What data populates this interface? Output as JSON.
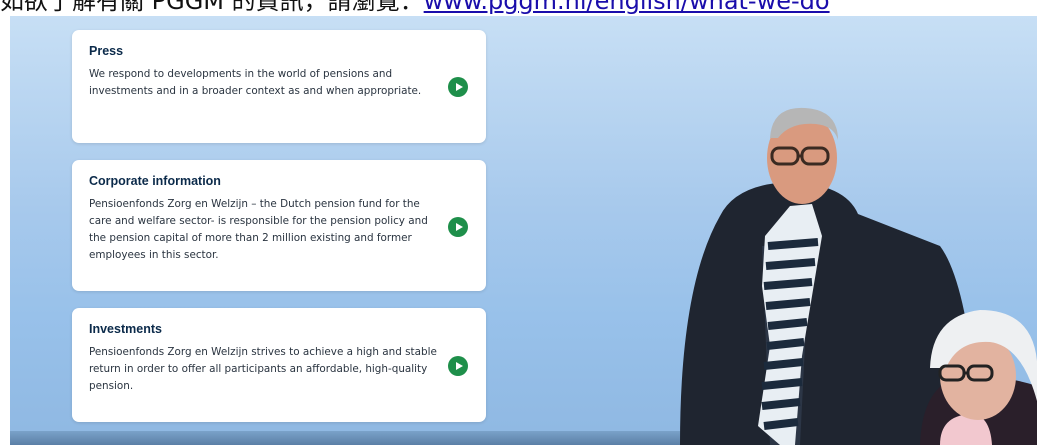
{
  "header": {
    "text": "如欲了解有關 PGGM 的資訊，請瀏覽：",
    "link_text": "www.pggm.nl/english/what-we-do"
  },
  "cards": [
    {
      "title": "Press",
      "body": "We respond to developments in the world of pensions and investments and in a broader context as and when appropriate."
    },
    {
      "title": "Corporate information",
      "body": "Pensioenfonds Zorg en Welzijn – the Dutch pension fund for the care and welfare sector- is responsible for the pension policy and the pension capital of more than 2 million existing and former employees in this sector."
    },
    {
      "title": "Investments",
      "body": "Pensioenfonds Zorg en Welzijn strives to achieve a high and stable return in order to offer all participants an affordable, high-quality pension."
    }
  ],
  "icons": {
    "card_action": "play-arrow-icon"
  },
  "colors": {
    "accent": "#1e8f4a",
    "title": "#0b2a4a",
    "link": "#1a0dab"
  }
}
